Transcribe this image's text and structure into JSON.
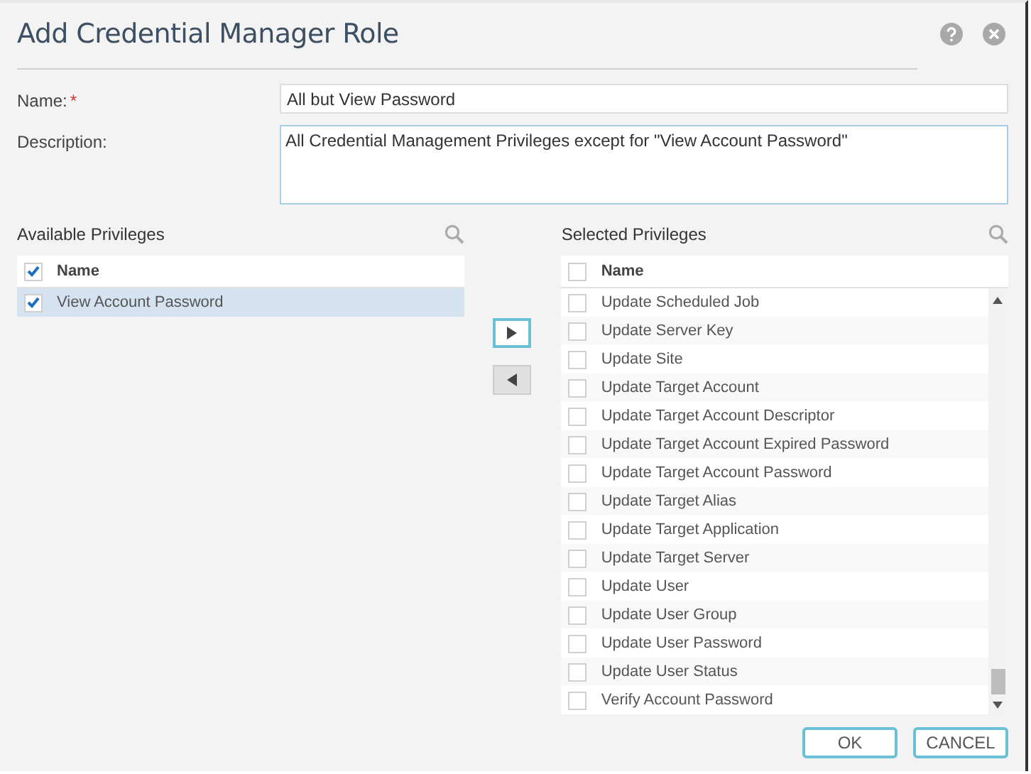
{
  "dialog": {
    "title": "Add Credential Manager Role"
  },
  "fields": [
    {
      "kind": "text",
      "label": "Name:",
      "required_mark": "*",
      "value": "All but View Password"
    },
    {
      "kind": "textarea",
      "label": "Description:",
      "value": "All Credential Management Privileges except for \"View Account Password\""
    }
  ],
  "available": {
    "title": "Available Privileges",
    "header": {
      "label": "Name",
      "checked": true
    },
    "rows": [
      {
        "label": "View Account Password",
        "checked": true,
        "selected": true
      }
    ]
  },
  "selected_list": {
    "title": "Selected Privileges",
    "header": {
      "label": "Name",
      "checked": false
    },
    "rows": [
      {
        "label": "Update Scheduled Job",
        "checked": false,
        "selected": false
      },
      {
        "label": "Update Server Key",
        "checked": false,
        "selected": false
      },
      {
        "label": "Update Site",
        "checked": false,
        "selected": false
      },
      {
        "label": "Update Target Account",
        "checked": false,
        "selected": false
      },
      {
        "label": "Update Target Account Descriptor",
        "checked": false,
        "selected": false
      },
      {
        "label": "Update Target Account Expired Password",
        "checked": false,
        "selected": false
      },
      {
        "label": "Update Target Account Password",
        "checked": false,
        "selected": false
      },
      {
        "label": "Update Target Alias",
        "checked": false,
        "selected": false
      },
      {
        "label": "Update Target Application",
        "checked": false,
        "selected": false
      },
      {
        "label": "Update Target Server",
        "checked": false,
        "selected": false
      },
      {
        "label": "Update User",
        "checked": false,
        "selected": false
      },
      {
        "label": "Update User Group",
        "checked": false,
        "selected": false
      },
      {
        "label": "Update User Password",
        "checked": false,
        "selected": false
      },
      {
        "label": "Update User Status",
        "checked": false,
        "selected": false
      },
      {
        "label": "Verify Account Password",
        "checked": false,
        "selected": false
      }
    ]
  },
  "buttons": [
    "OK",
    "CANCEL"
  ]
}
